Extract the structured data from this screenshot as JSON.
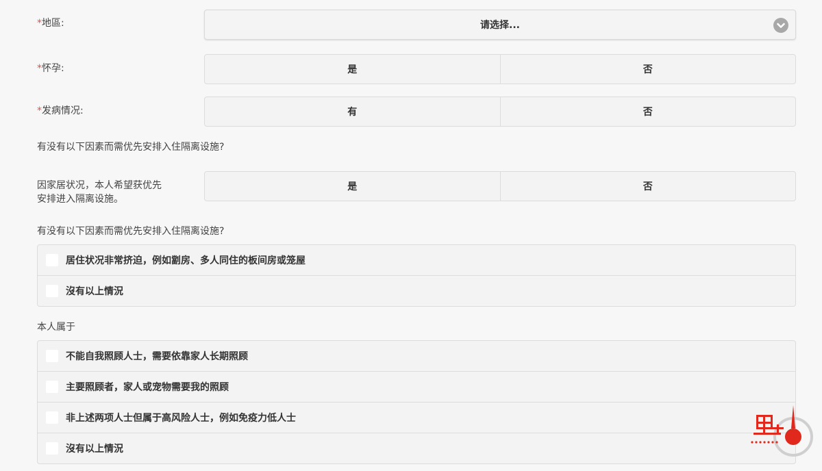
{
  "form": {
    "required_mark": "*",
    "region": {
      "label": "地區:",
      "placeholder": "请选择..."
    },
    "pregnant": {
      "label": "怀孕:",
      "options": [
        "是",
        "否"
      ]
    },
    "symptoms": {
      "label": "发病情况:",
      "options": [
        "有",
        "否"
      ]
    },
    "priority_question_1": "有没有以下因素而需优先安排入住隔离设施?",
    "home_situation": {
      "label_line1": "因家居状况，本人希望获优先",
      "label_line2": "安排进入隔离设施。",
      "options": [
        "是",
        "否"
      ]
    },
    "priority_question_2": "有没有以下因素而需优先安排入住隔离设施?",
    "housing_checklist": [
      "居住状况非常挤迫，例如劏房、多人同住的板间房或笼屋",
      "沒有以上情況"
    ],
    "self_belongs_label": "本人属于",
    "self_checklist": [
      "不能自我照顾人士，需要依靠家人长期照顾",
      "主要照顾者，家人或宠物需要我的照顾",
      "非上述两项人士但属于高风险人士，例如免疫力低人士",
      "沒有以上情況"
    ]
  },
  "icons": {
    "dropdown": "chevron-down-circle-icon",
    "logo": "brand-logo-icon"
  },
  "colors": {
    "required": "#d9534f",
    "logo_red": "#e0281d"
  }
}
